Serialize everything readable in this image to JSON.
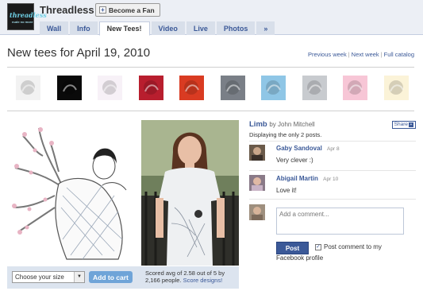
{
  "header": {
    "logo_text": "threadless",
    "logo_subtext": "nude no more",
    "page_name": "Threadless",
    "fan_button_label": "Become a Fan",
    "tabs": [
      {
        "label": "Wall"
      },
      {
        "label": "Info"
      },
      {
        "label": "New Tees!"
      },
      {
        "label": "Video"
      },
      {
        "label": "Live"
      },
      {
        "label": "Photos"
      },
      {
        "label": "»"
      }
    ],
    "active_tab": "New Tees!"
  },
  "main": {
    "headline": "New tees for April 19, 2010",
    "week_nav": {
      "previous": "Previous week",
      "next": "Next week",
      "catalog": "Full catalog"
    },
    "thumbnails": [
      {
        "name": "thumb-1",
        "color": "#f2f2f2"
      },
      {
        "name": "thumb-2",
        "color": "#0a0a0a"
      },
      {
        "name": "thumb-3",
        "color": "#f7f1f7"
      },
      {
        "name": "thumb-4",
        "color": "#b81e2e"
      },
      {
        "name": "thumb-5",
        "color": "#d93b22"
      },
      {
        "name": "thumb-6",
        "color": "#7a7f87"
      },
      {
        "name": "thumb-7",
        "color": "#8fc6e6"
      },
      {
        "name": "thumb-8",
        "color": "#c8cbcf"
      },
      {
        "name": "thumb-9",
        "color": "#f7c6d6"
      },
      {
        "name": "thumb-10",
        "color": "#fbf3d8"
      }
    ]
  },
  "product": {
    "size_select_value": "Choose your size",
    "add_to_cart_label": "Add to cart",
    "score_text": "Scored avg of 2.58 out of 5 by 2,166 people.",
    "score_link": "Score designs!"
  },
  "side": {
    "design_title": "Limb",
    "by_label": "by John Mitchell",
    "share_label": "Share",
    "post_count": "Displaying the only 2 posts.",
    "posts": [
      {
        "author": "Gaby Sandoval",
        "date": "Apr 8",
        "text": "Very clever :)"
      },
      {
        "author": "Abigail Martin",
        "date": "Apr 10",
        "text": "Love it!"
      }
    ],
    "comment_placeholder": "Add a comment...",
    "post_button_label": "Post",
    "post_to_profile_label_1": "Post comment to my",
    "post_to_profile_label_2": "Facebook profile",
    "post_to_profile_checked": true
  },
  "colors": {
    "brand": "#3b5998",
    "header_bg": "#eceff5",
    "tab_bg": "#d8dfea",
    "buy_bar_bg": "#dce4ef",
    "cart_button": "#6fa4d8"
  }
}
